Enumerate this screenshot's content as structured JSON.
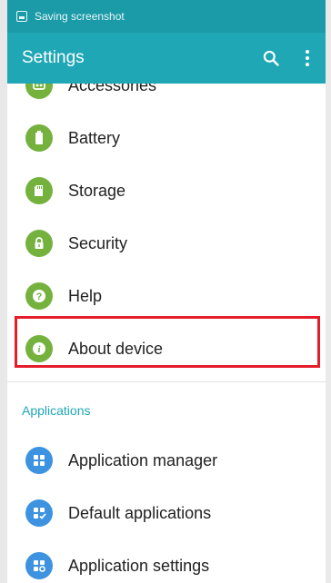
{
  "status_bar": {
    "notification_text": "Saving screenshot"
  },
  "app_bar": {
    "title": "Settings"
  },
  "settings_items": [
    {
      "label": "Accessories",
      "icon": "accessories-icon"
    },
    {
      "label": "Battery",
      "icon": "battery-icon"
    },
    {
      "label": "Storage",
      "icon": "storage-icon"
    },
    {
      "label": "Security",
      "icon": "lock-icon"
    },
    {
      "label": "Help",
      "icon": "help-icon"
    },
    {
      "label": "About device",
      "icon": "info-icon"
    }
  ],
  "applications_section": {
    "header": "Applications",
    "items": [
      {
        "label": "Application manager",
        "icon": "apps-grid-icon"
      },
      {
        "label": "Default applications",
        "icon": "default-apps-icon"
      },
      {
        "label": "Application settings",
        "icon": "app-settings-icon"
      }
    ]
  },
  "colors": {
    "status_bar": "#1b9aa7",
    "app_bar": "#1fa7b6",
    "green_icon": "#74b23d",
    "blue_icon": "#3d93e0",
    "highlight_border": "#e51d2a",
    "section_header": "#1fa7b6"
  }
}
